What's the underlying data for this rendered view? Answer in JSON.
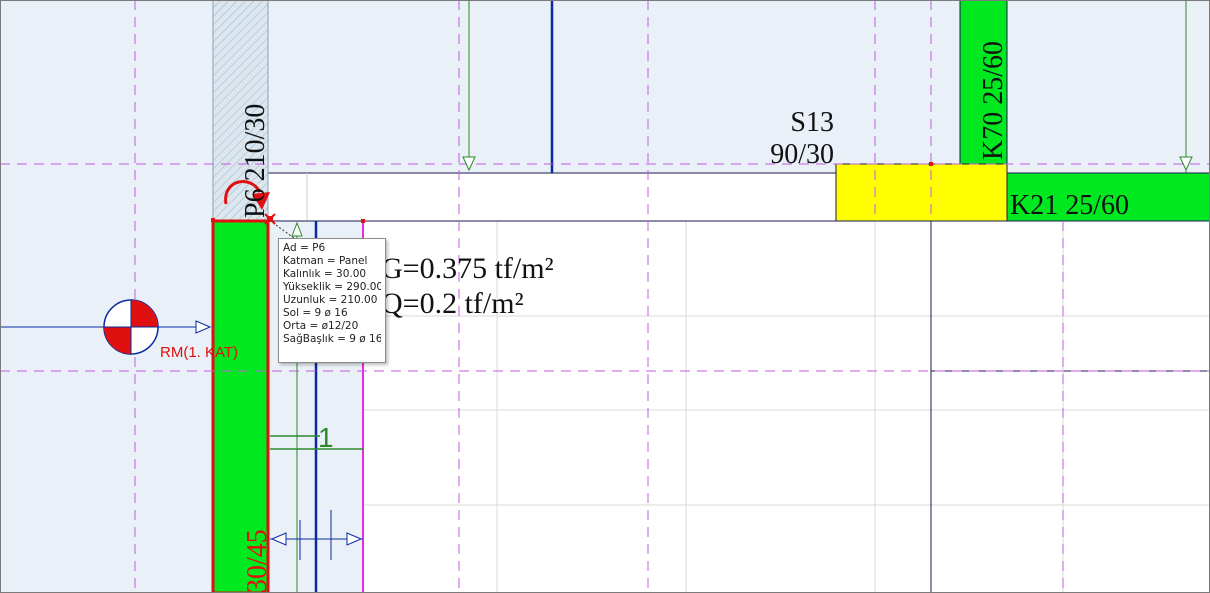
{
  "labels": {
    "beam_k70": "K70 25/60",
    "beam_k21": "K21 25/60",
    "column_s13_name": "S13",
    "column_s13_size": "90/30",
    "panel_p6_vertical": "P6 210/30",
    "load_g": "G=0.375 tf/m²",
    "load_q": "Q=0.2 tf/m²",
    "rm_label": "RM(1. KAT)",
    "bottom_vertical_label": "30/45",
    "stair_number": "1"
  },
  "tooltip": {
    "lines": [
      "Ad = P6",
      "Katman = Panel",
      "Kalınlık = 30.00",
      "Yükseklik = 290.00",
      "Uzunluk = 210.00",
      "Sol = 9 ø 16",
      "Orta = ø12/20",
      "SağBaşlık = 9 ø 16"
    ]
  },
  "colors": {
    "background": "#ffffff",
    "slab_region": "#eaf0f7",
    "beam_green": "#00e81f",
    "column_yellow": "#ffff00",
    "axis_dash": "#c35ae0",
    "magenta": "#e82ce0",
    "blue_line": "#0a2aa0",
    "red": "#e01010",
    "grid": "#d8d8d8",
    "arrow_green": "#2a8a2a"
  },
  "icons": {
    "rotate_cursor": "rotate-arrow-icon",
    "cross_cursor": "cross-cursor-icon",
    "mass_center": "mass-center-icon"
  }
}
